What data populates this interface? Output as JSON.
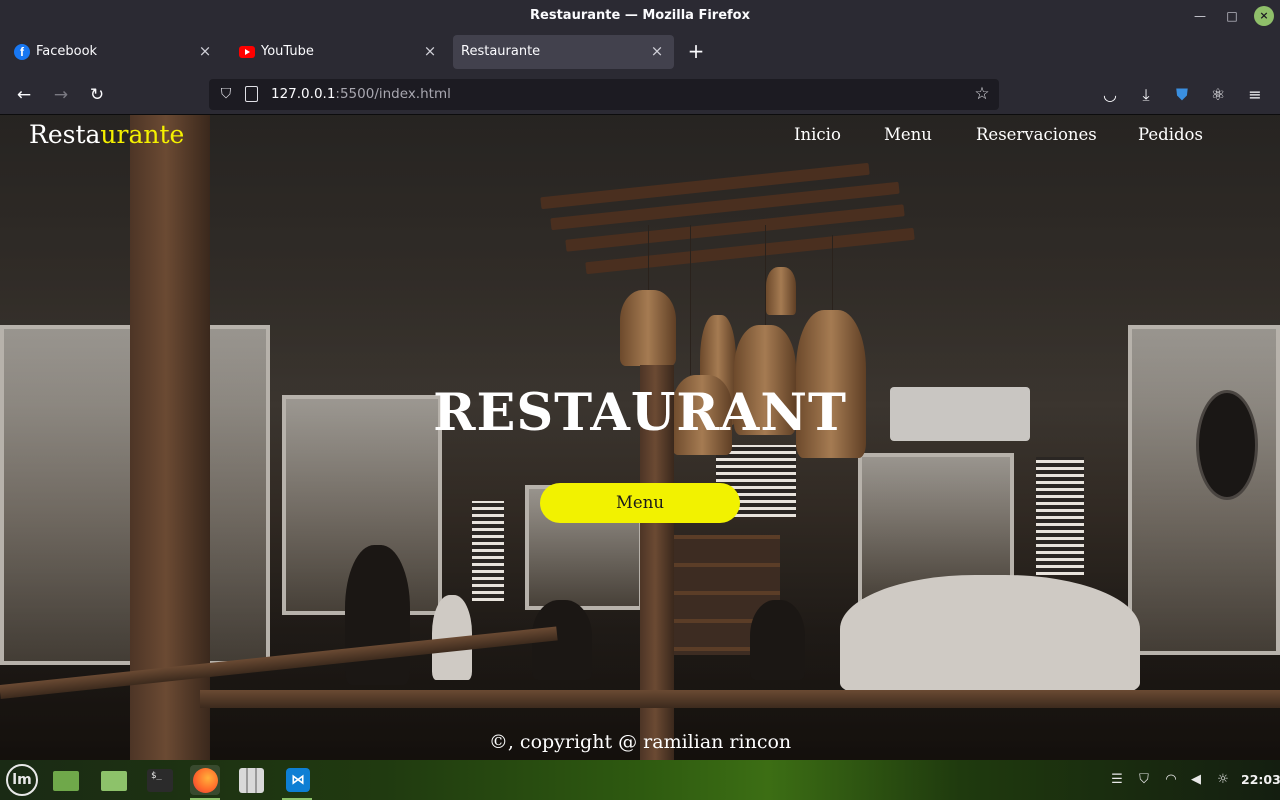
{
  "window": {
    "title": "Restaurante — Mozilla Firefox"
  },
  "tabs": [
    {
      "label": "Facebook",
      "favicon": "facebook-icon",
      "active": false
    },
    {
      "label": "YouTube",
      "favicon": "youtube-icon",
      "active": false
    },
    {
      "label": "Restaurante",
      "favicon": "",
      "active": true
    }
  ],
  "urlbar": {
    "host": "127.0.0.1",
    "rest": ":5500/index.html"
  },
  "site": {
    "logo_main": "Resta",
    "logo_accent": "urante",
    "nav": [
      "Inicio",
      "Menu",
      "Reservaciones",
      "Pedidos"
    ],
    "hero_title": "RESTAURANT",
    "hero_button": "Menu",
    "footer": "©, copyright @ ramilian rincon",
    "accent_color": "#f5f100"
  },
  "taskbar": {
    "clock": "22:03"
  },
  "icons": {
    "back": "←",
    "forward": "→",
    "reload": "↻",
    "star": "☆",
    "newtab": "+",
    "close": "×",
    "minimize": "—",
    "maximize": "□",
    "window_close": "×",
    "menu": "≡",
    "download": "⤓"
  }
}
